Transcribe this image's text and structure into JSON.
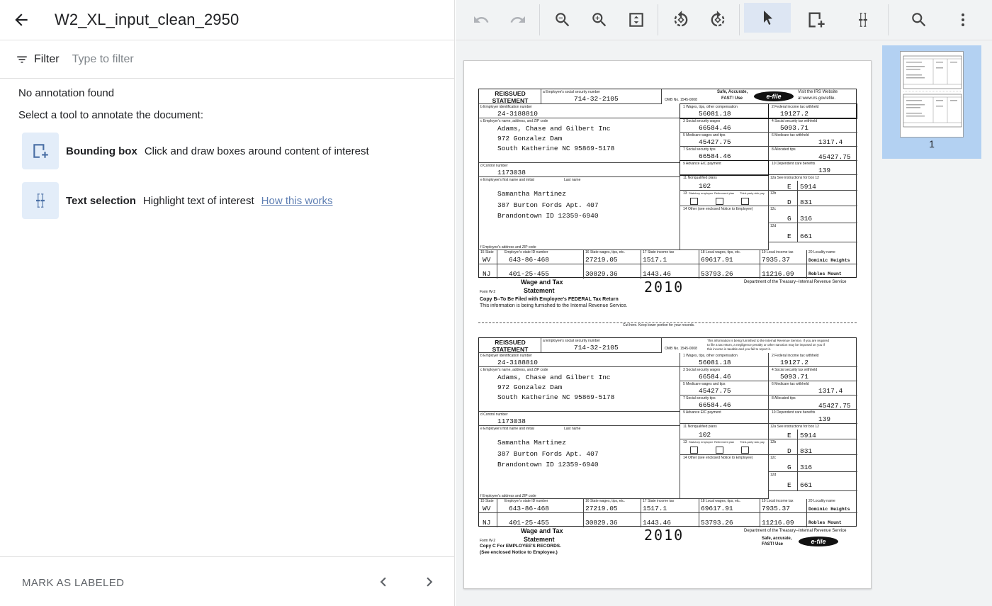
{
  "header": {
    "title": "W2_XL_input_clean_2950",
    "back_icon": "arrow-left-icon"
  },
  "filter": {
    "label": "Filter",
    "placeholder": "Type to filter"
  },
  "messages": {
    "no_annotation": "No annotation found",
    "select_tool": "Select a tool to annotate the document:"
  },
  "tools": [
    {
      "name": "Bounding box",
      "description": "Click and draw boxes around content of interest",
      "icon": "bounding-box-icon"
    },
    {
      "name": "Text selection",
      "description": "Highlight text of interest",
      "link": "How this works",
      "icon": "text-cursor-icon"
    }
  ],
  "footer": {
    "mark_label": "MARK AS LABELED"
  },
  "toolbar": {
    "buttons": [
      "undo-icon",
      "redo-icon",
      "zoom-out-icon",
      "zoom-in-icon",
      "fit-page-icon",
      "rotate-left-icon",
      "rotate-right-icon",
      "pointer-icon",
      "add-box-icon",
      "text-select-icon",
      "search-icon",
      "more-vert-icon"
    ],
    "active": "pointer-icon",
    "active_color": "#dde6f3"
  },
  "thumbnail": {
    "page_number": "1",
    "highlight_color": "#b3d1f2"
  },
  "w2": {
    "reissued": "REISSUED",
    "statement": "STATEMENT",
    "ssn_label": "a  Employee's social security number",
    "ssn": "714-32-2105",
    "omb": "OMB No. 1545-0008",
    "safe_text": "Safe, Accurate,",
    "fast_text": "FAST! Use",
    "efile": "e-file",
    "irs_text1": "Visit the IRS Website",
    "irs_text2": "at www.irs.gov/efile.",
    "notice_text1": "This information is being furnished to the Internal Revenue Service. If you are required",
    "notice_text2": "to file a tax return, a negligence penalty or other sanction may be imposed on you if",
    "notice_text3": "this income is taxable and you fail to report it.",
    "ein_label": "b  Employer identification number",
    "ein": "24-3188810",
    "employer_label": "c  Employer's name, address, and ZIP code",
    "employer_line1": "Adams, Chase and Gilbert Inc",
    "employer_line2": "972 Gonzalez Dam",
    "employer_line3": "South Katherine    NC    95869-5178",
    "control_label": "d  Control number",
    "control": "1173038",
    "employee_label": "e  Employee's first name and initial",
    "last_name_label": "Last name",
    "employee_line1": "Samantha   Martinez",
    "employee_line2": "387 Burton Fords Apt. 407",
    "employee_line3": "Brandontown   ID     12359-6940",
    "emp_addr_label": "f  Employee's address and ZIP code",
    "box1_label": "1    Wages, tips, other compensation",
    "box1": "56081.18",
    "box2_label": "2    Federal income tax withheld",
    "box2": "19127.2",
    "box3_label": "3    Social security wages",
    "box3": "66584.46",
    "box4_label": "4    Social security tax withheld",
    "box4": "5093.71",
    "box5_label": "5    Medicare wages and tips",
    "box5": "45427.75",
    "box6_label": "6    Medicare tax withheld",
    "box6": "1317.4",
    "box7_label": "7    Social security tips",
    "box7": "66584.46",
    "box8_label": "8    Allocated tips",
    "box8": "45427.75",
    "box9_label": "9    Advance EIC payment",
    "box10_label": "10    Dependent care benefits",
    "box10": "139",
    "box11_label": "11    Nonqualified plans",
    "box11": "102",
    "box12_label": "12a  See instructions for box 12",
    "box12a_code": "E",
    "box12a": "5914",
    "box12b_label": "12b",
    "box12b_code": "D",
    "box12b": "831",
    "box12c_label": "12c",
    "box12c_code": "G",
    "box12c": "316",
    "box12d_label": "12d",
    "box12d_code": "E",
    "box12d": "661",
    "box13_statutory": "Statutory employee",
    "box13_retirement": "Retirement plan",
    "box13_thirdparty": "Third-party sick pay",
    "box13_label": "13",
    "box14_label": "14    Other (see enclosed Notice to Employee)",
    "state_hdr": "15  State",
    "state_id_hdr": "Employer's state ID number",
    "state_wages_hdr": "16  State wages, tips, etc.",
    "state_tax_hdr": "17  State income tax",
    "local_wages_hdr": "18  Local wages, tips, etc.",
    "local_tax_hdr": "19  Local income tax",
    "locality_hdr": "20  Locality name",
    "row1_state": "WV",
    "row1_id": "643-86-468",
    "row1_wages": "27219.05",
    "row1_tax": "1517.1",
    "row1_lwages": "69617.91",
    "row1_ltax": "7935.37",
    "row1_locality": "Dominic Heights",
    "row2_state": "NJ",
    "row2_id": "401-25-455",
    "row2_wages": "30829.36",
    "row2_tax": "1443.46",
    "row2_lwages": "53793.26",
    "row2_ltax": "11216.09",
    "row2_locality": "Robles Mount",
    "form_w2": "Form  W-2",
    "wage_tax1": "Wage and Tax",
    "wage_tax2": "Statement",
    "year": "2010",
    "dept": "Department of the Treasury--Internal Revenue Service",
    "copyb1": "Copy B--To Be Filed with Employee's FEDERAL Tax Return",
    "copyb2": "This information is being furnished to the Internal Revenue Service.",
    "cut_text": "Cut here. Keep lower portion for your records.",
    "copyc1": "Copy C For EMPLOYEE'S RECORDS.",
    "copyc2": "(See enclosed Notice to Employee.)",
    "safe2": "Safe, accurate,",
    "fast2": "FAST! Use"
  }
}
